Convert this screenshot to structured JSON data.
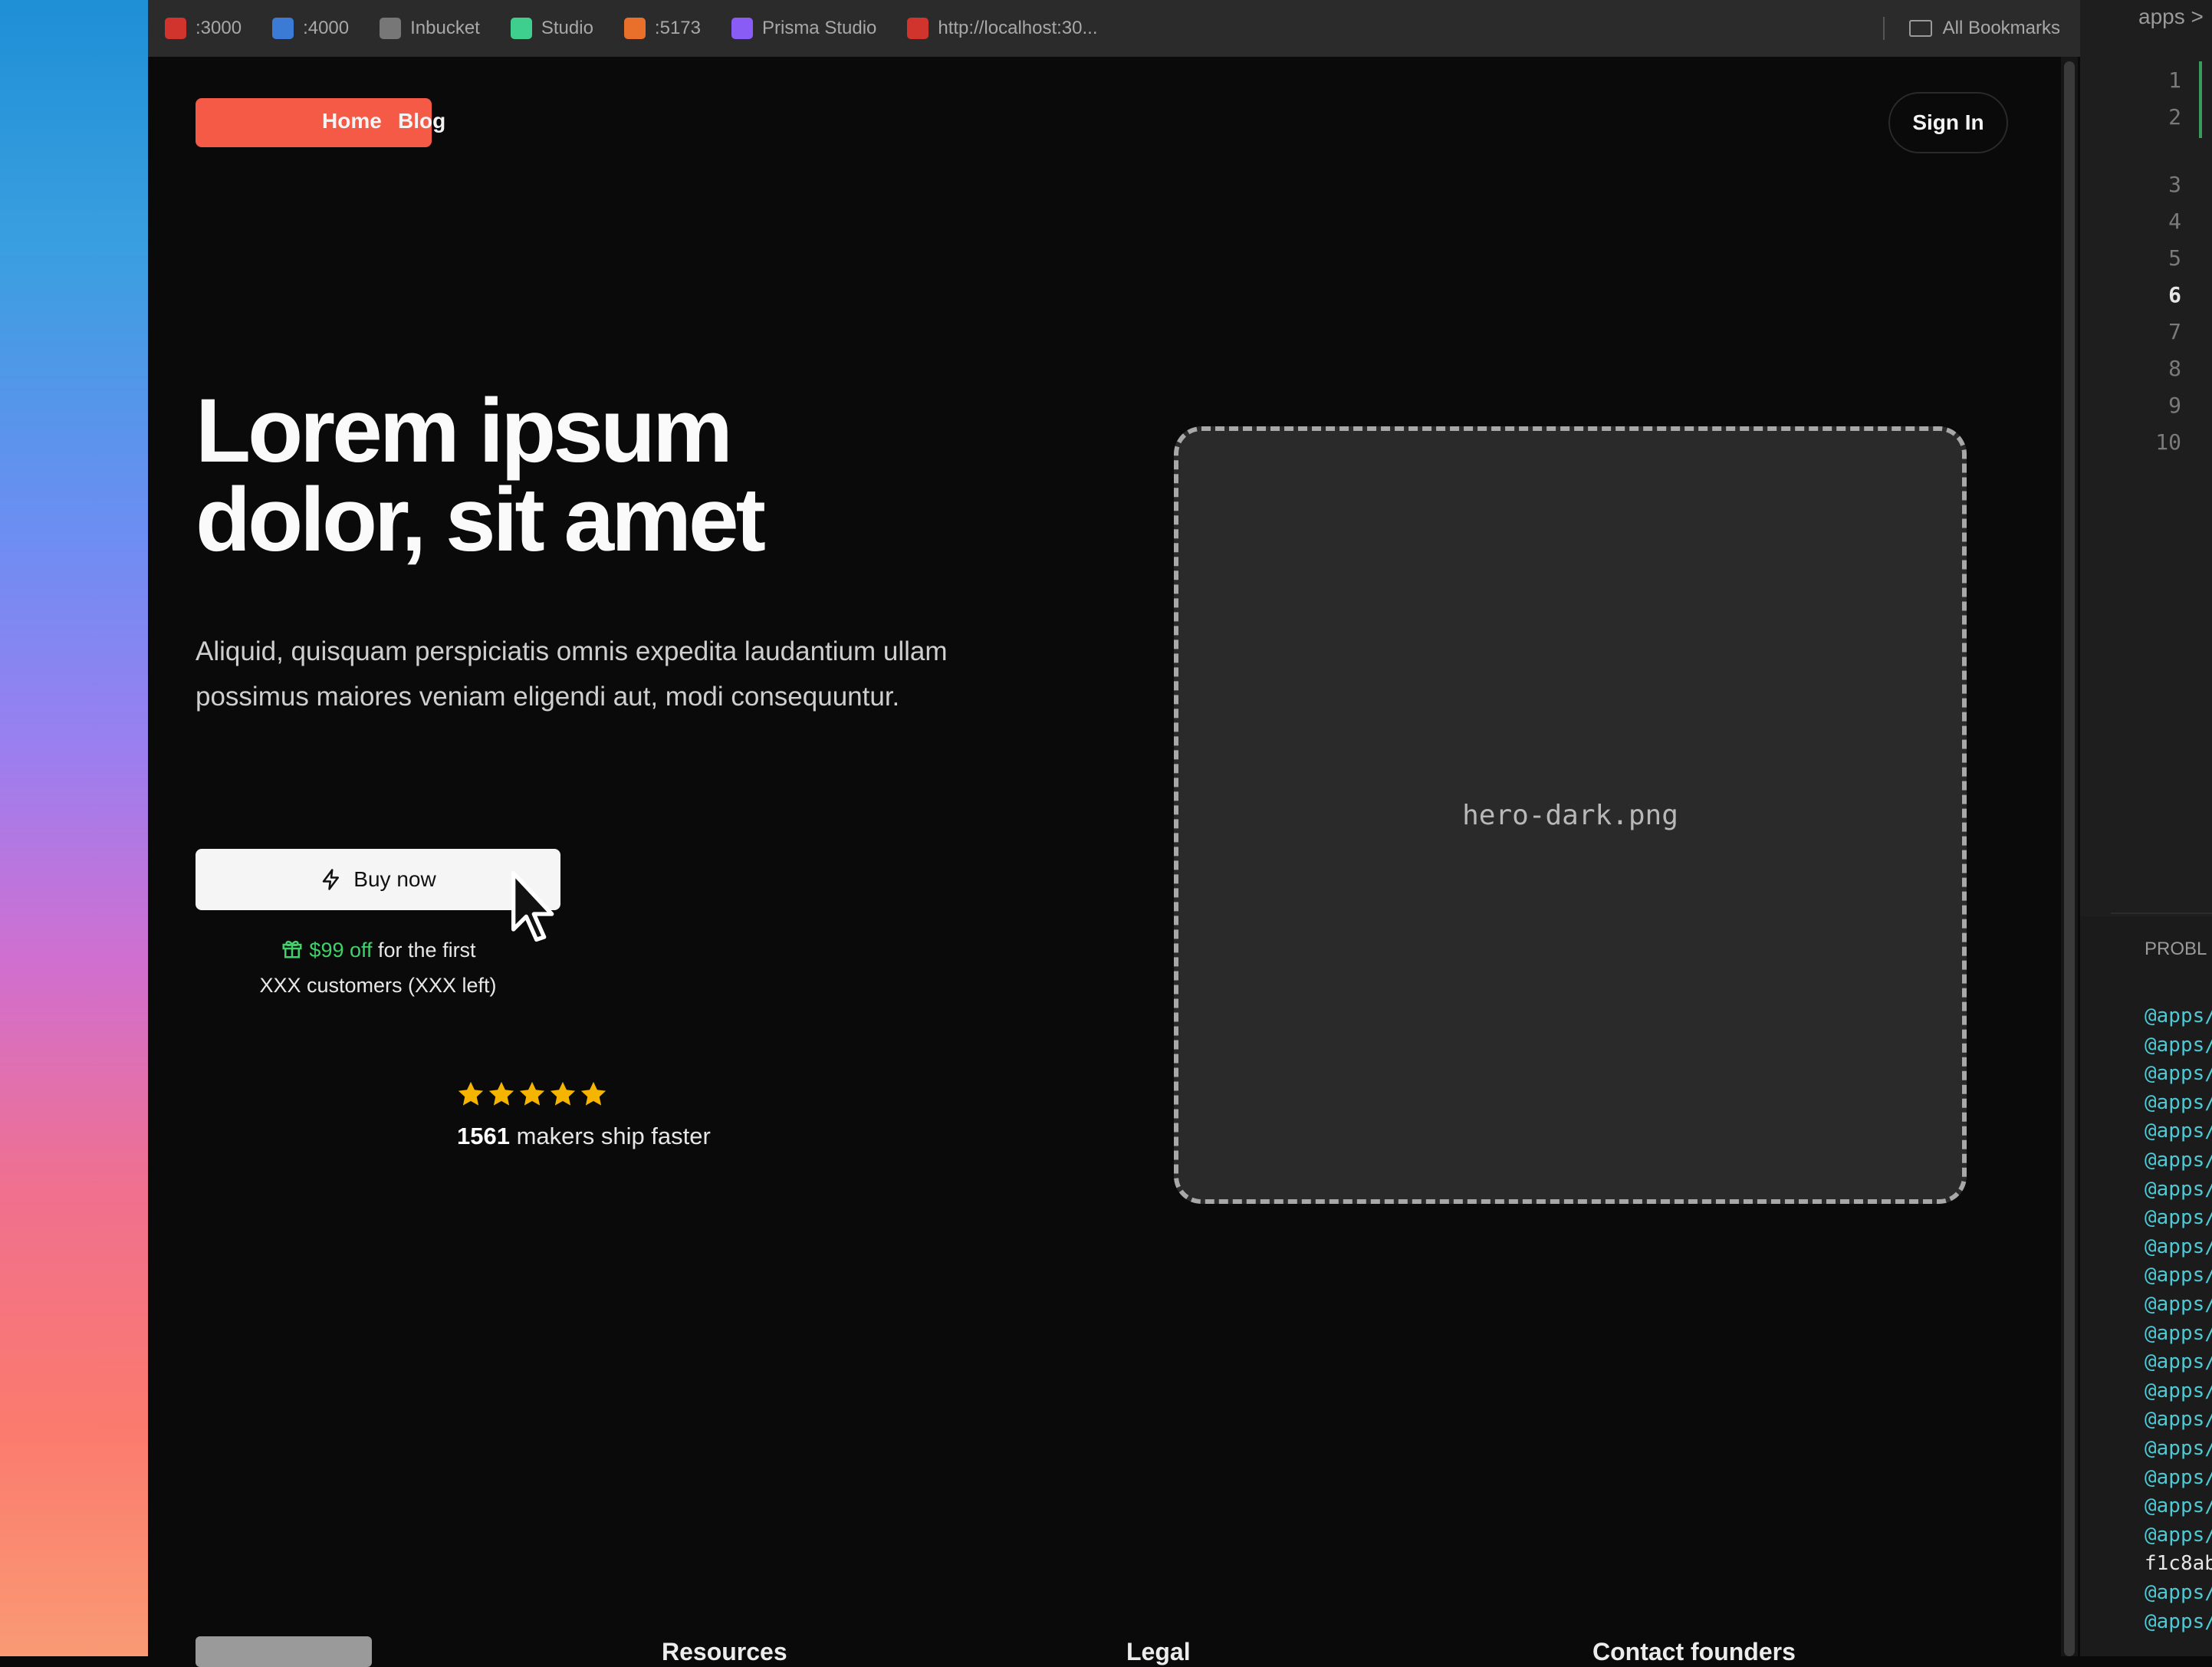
{
  "bookmarks": [
    {
      "label": ":3000",
      "icon": "localhost-icon",
      "color": "#d0342c"
    },
    {
      "label": ":4000",
      "icon": "grid-icon",
      "color": "#3b7bd6"
    },
    {
      "label": "Inbucket",
      "icon": "at-icon",
      "color": "#777777"
    },
    {
      "label": "Studio",
      "icon": "bolt-icon",
      "color": "#3ecf8e"
    },
    {
      "label": ":5173",
      "icon": "m-icon",
      "color": "#e8702a"
    },
    {
      "label": "Prisma Studio",
      "icon": "prisma-icon",
      "color": "#8a5cf6"
    },
    {
      "label": "http://localhost:30...",
      "icon": "localhost-icon",
      "color": "#d0342c"
    }
  ],
  "bookmarks_folder": "All Bookmarks",
  "nav": {
    "home": "Home",
    "blog": "Blog",
    "signin": "Sign In"
  },
  "hero": {
    "title_line1": "Lorem ipsum",
    "title_line2": "dolor, sit amet",
    "subtitle": "Aliquid, quisquam perspiciatis omnis expedita laudantium ullam possimus maiores veniam eligendi aut, modi consequuntur.",
    "cta": "Buy now",
    "discount_amount": "$99 off",
    "discount_text": " for the first",
    "discount_line2": "XXX customers (XXX left)",
    "rating": 5,
    "makers_count": "1561",
    "makers_text": " makers ship faster",
    "image_placeholder": "hero-dark.png"
  },
  "footer": {
    "col1": "Resources",
    "col2": "Legal",
    "col3": "Contact founders"
  },
  "colors": {
    "brand": "#f45a46",
    "discount": "#3fd16a",
    "star": "#f5b400"
  },
  "editor": {
    "path_fragment": "apps >",
    "line_numbers": [
      "1",
      "2",
      "3",
      "4",
      "5",
      "6",
      "7",
      "8",
      "9",
      "10"
    ],
    "active_line": "6",
    "problems_tab": "PROBL",
    "terminal_prefix": "@apps/",
    "terminal_hash": "f1c8ab"
  }
}
